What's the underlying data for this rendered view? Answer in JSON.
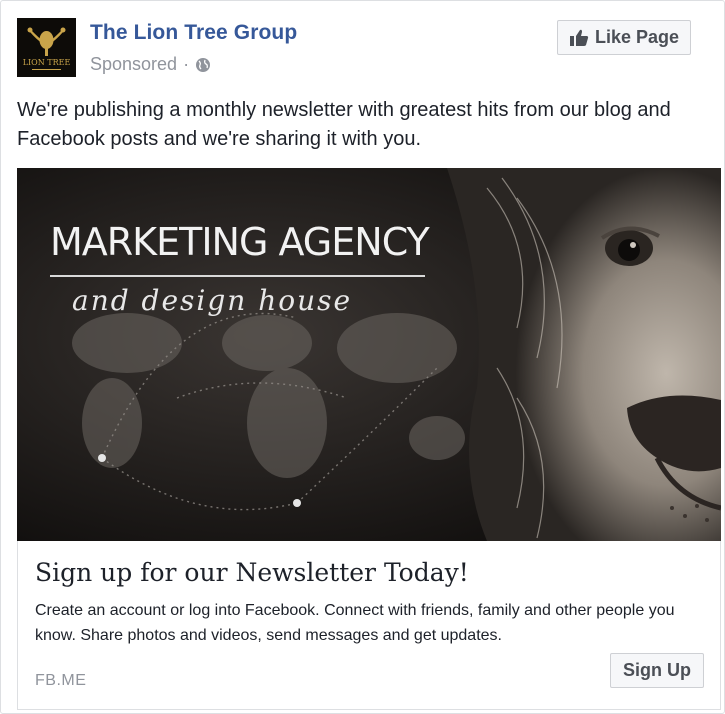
{
  "header": {
    "page_name": "The Lion Tree Group",
    "sponsored": "Sponsored",
    "separator": "·",
    "audience_icon": "globe-icon",
    "avatar_text": "LION TREE",
    "like_button": "Like Page",
    "like_icon": "thumbs-up-icon"
  },
  "post": {
    "text": "We're publishing a monthly newsletter with greatest hits from our blog and Facebook posts and we're sharing it with you."
  },
  "image": {
    "headline": "MARKETING AGENCY",
    "subline": "and design house"
  },
  "link": {
    "title": "Sign up for our Newsletter Today!",
    "description": "Create an account or log into Facebook. Connect with friends, family and other people you know. Share photos and videos, send messages and get updates.",
    "domain": "FB.ME",
    "cta": "Sign Up"
  },
  "colors": {
    "page_name": "#365899",
    "meta": "#90949c",
    "button_bg": "#f6f7f9",
    "button_border": "#ced0d4",
    "card_border": "#dddfe2"
  }
}
